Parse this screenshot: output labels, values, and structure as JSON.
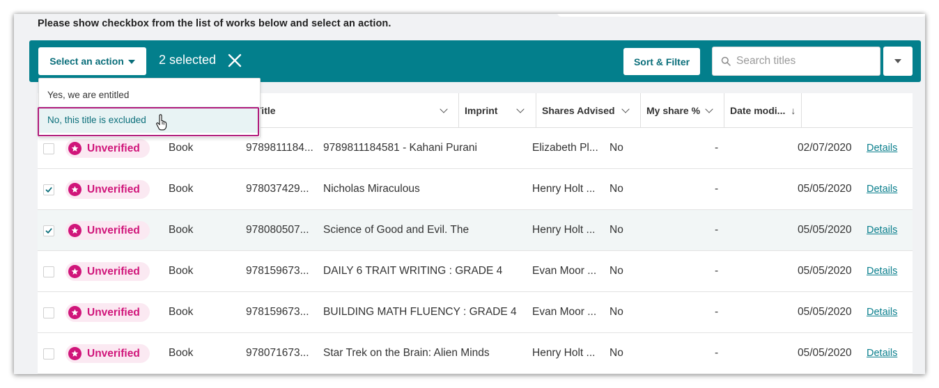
{
  "instruction": "Please show checkbox from the list of works below and select an action.",
  "toolbar": {
    "action_label": "Select an action",
    "selected_count": "2 selected",
    "sort_filter_label": "Sort & Filter",
    "search_placeholder": "Search titles"
  },
  "menu": {
    "items": [
      "Yes, we are entitled",
      "No, this title is excluded"
    ],
    "hovered_index": 1
  },
  "table": {
    "columns": [
      {
        "label": "",
        "sort": "none"
      },
      {
        "label": "Title",
        "sort": "chevron"
      },
      {
        "label": "Imprint",
        "sort": "chevron"
      },
      {
        "label": "Shares Advised",
        "sort": "chevron"
      },
      {
        "label": "My share %",
        "sort": "chevron"
      },
      {
        "label": "Date modi...",
        "sort": "descending"
      }
    ],
    "rows": [
      {
        "checked": false,
        "status": "Unverified",
        "type": "Book",
        "isbn": "9789811184...",
        "title": "9789811184581 - Kahani Purani",
        "imprint": "Elizabeth Pl...",
        "shares": "No",
        "my_share": "-",
        "date": "02/07/2020",
        "action": "Details"
      },
      {
        "checked": true,
        "status": "Unverified",
        "type": "Book",
        "isbn": "978037429...",
        "title": "Nicholas Miraculous",
        "imprint": "Henry Holt ...",
        "shares": "No",
        "my_share": "-",
        "date": "05/05/2020",
        "action": "Details"
      },
      {
        "checked": true,
        "status": "Unverified",
        "type": "Book",
        "isbn": "978080507...",
        "title": "Science of Good and Evil. The",
        "imprint": "Henry Holt ...",
        "shares": "No",
        "my_share": "-",
        "date": "05/05/2020",
        "action": "Details"
      },
      {
        "checked": false,
        "status": "Unverified",
        "type": "Book",
        "isbn": "978159673...",
        "title": "DAILY 6 TRAIT WRITING : GRADE 4",
        "imprint": "Evan Moor ...",
        "shares": "No",
        "my_share": "-",
        "date": "05/05/2020",
        "action": "Details"
      },
      {
        "checked": false,
        "status": "Unverified",
        "type": "Book",
        "isbn": "978159673...",
        "title": "BUILDING MATH FLUENCY : GRADE 4",
        "imprint": "Evan Moor ...",
        "shares": "No",
        "my_share": "-",
        "date": "05/05/2020",
        "action": "Details"
      },
      {
        "checked": false,
        "status": "Unverified",
        "type": "Book",
        "isbn": "978071673...",
        "title": "Star Trek on the Brain: Alien Minds",
        "imprint": "Henry Holt ...",
        "shares": "No",
        "my_share": "-",
        "date": "05/05/2020",
        "action": "Details"
      }
    ]
  },
  "colors": {
    "toolbar_bg": "#037f8c",
    "accent_teal": "#0a6e7a",
    "status_pink": "#d0157a",
    "badge_bg": "#fbe9f2",
    "highlight_border": "#b01a7a"
  },
  "icons": {
    "caret": "caret-down-icon",
    "close": "close-icon",
    "search": "search-icon",
    "status": "star-icon",
    "check": "checkmark-icon",
    "cursor": "hand-pointer-icon"
  }
}
